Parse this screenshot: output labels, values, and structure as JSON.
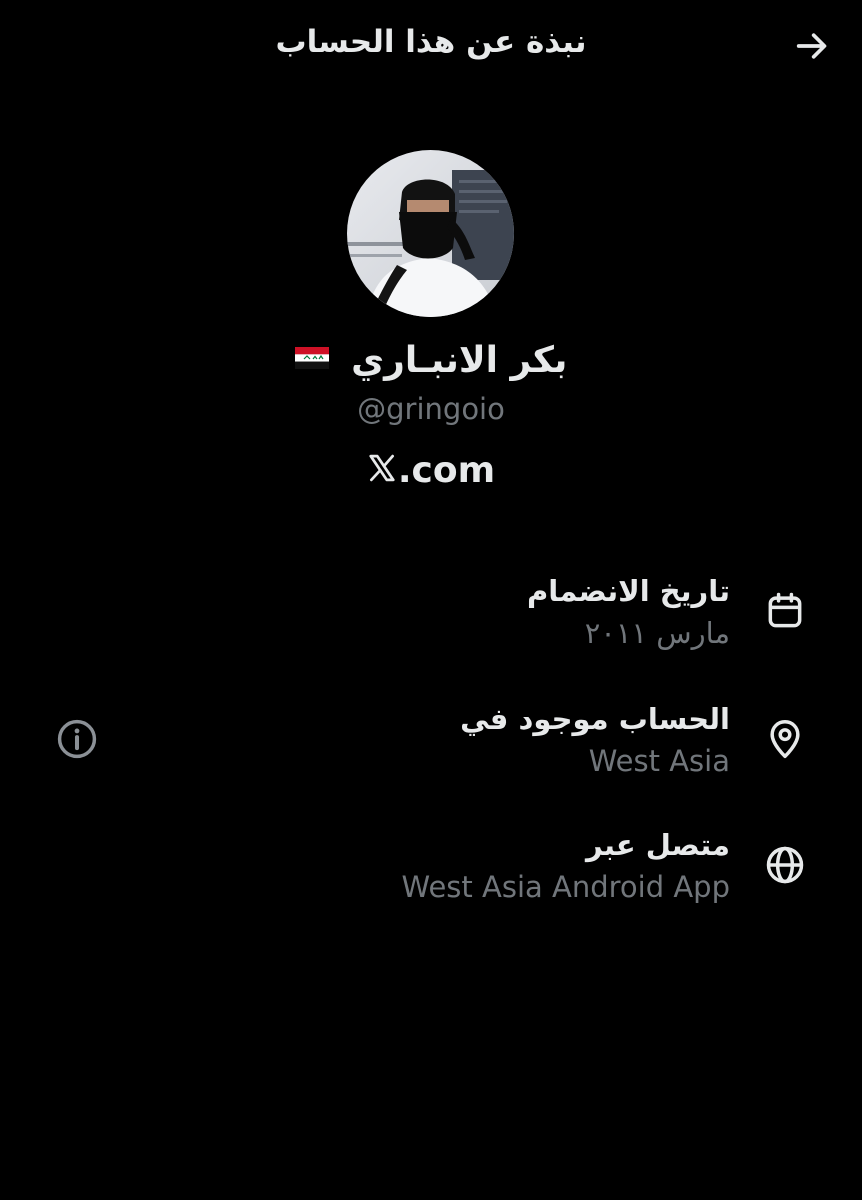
{
  "header": {
    "title": "نبذة عن هذا الحساب",
    "back_icon": "arrow-right-icon"
  },
  "profile": {
    "display_name": "بكر الانبـاري",
    "flag_icon": "iraq-flag-icon",
    "handle": "@gringoio",
    "site_suffix": ".com"
  },
  "details": [
    {
      "icon": "calendar-icon",
      "label": "تاريخ الانضمام",
      "value": "مارس ٢٠١١"
    },
    {
      "icon": "location-pin-icon",
      "label": "الحساب موجود في",
      "value": "West Asia"
    },
    {
      "icon": "globe-icon",
      "label": "متصل عبر",
      "value": "West Asia Android App"
    }
  ],
  "colors": {
    "background": "#000000",
    "primary_text": "#e7e9ea",
    "secondary_text": "#71767b",
    "icon": "#e7e9ea"
  }
}
